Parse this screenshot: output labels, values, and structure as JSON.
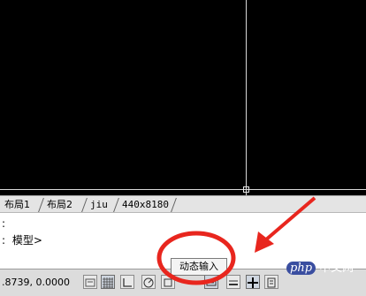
{
  "layout_tabs": [
    "布局1",
    "布局2",
    "jiu",
    "440x8180"
  ],
  "command_line": {
    "line1": ":",
    "line2_prefix": ":",
    "line2_text": "模型>"
  },
  "status_bar": {
    "coordinates": ".8739, 0.0000",
    "tooltip": "动态输入",
    "buttons": [
      "infer-constraints",
      "snap-mode",
      "grid-display",
      "ortho-mode",
      "polar-tracking",
      "object-snap",
      "object-snap-tracking",
      "dynamic-input",
      "lineweight",
      "quick-properties"
    ]
  },
  "colors": {
    "canvas": "#000000",
    "annotation": "#e8261e",
    "crosshair": "#d8d8d8"
  },
  "watermark": {
    "logo": "php",
    "text": "中文网"
  }
}
